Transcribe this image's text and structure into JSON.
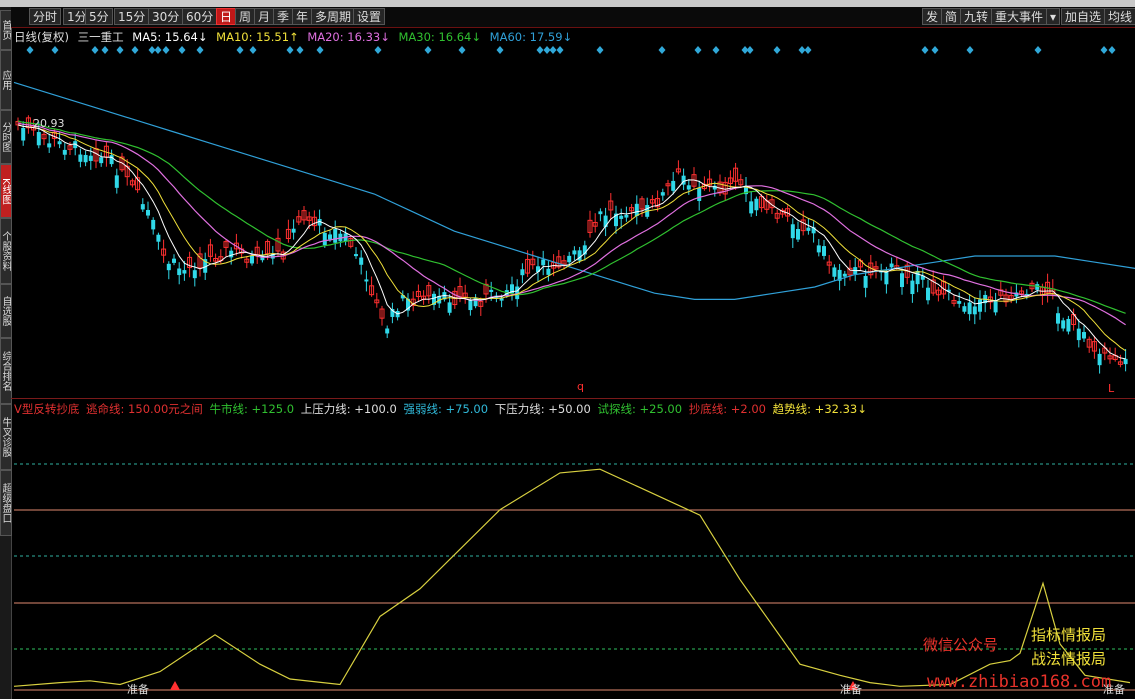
{
  "toolbar": {
    "periods": [
      "分时",
      "1分",
      "5分",
      "15分",
      "30分",
      "60分",
      "日",
      "周",
      "月",
      "季",
      "年",
      "多周期",
      "设置"
    ],
    "active_period": "日",
    "right_buttons": [
      "发",
      "简",
      "九转",
      "重大事件",
      "▾",
      "加自选",
      "均线"
    ]
  },
  "sidebar": {
    "tabs": [
      "首页",
      "应用",
      "分时图",
      "K线图",
      "个股资料",
      "自选股",
      "综合排名",
      "牛叉诊股",
      "超级盘口"
    ],
    "active": "K线图"
  },
  "kline_header": {
    "title": "日线(复权)",
    "stock": "三一重工",
    "ma5": "MA5: 15.64↓",
    "ma10": "MA10: 15.51↑",
    "ma20": "MA20: 16.33↓",
    "ma30": "MA30: 16.64↓",
    "ma60": "MA60: 17.59↓",
    "high_label": "20.93",
    "marker_q": "q",
    "marker_l": "L"
  },
  "colors": {
    "ma5": "#ffffff",
    "ma10": "#f0e03a",
    "ma20": "#e070e0",
    "ma30": "#30c030",
    "ma60": "#30a0d8",
    "up": "#ff3030",
    "down": "#30d8e8",
    "indicator": "#d8d040"
  },
  "indicator_header": {
    "name": "V型反转抄底",
    "escape": "逃命线: 150.00元之间",
    "bull": "牛市线: +125.0",
    "upper": "上压力线: +100.0",
    "strong": "强弱线: +75.00",
    "lower": "下压力线: +50.00",
    "test": "试探线: +25.00",
    "bottom": "抄底线: +2.00",
    "trend": "趋势线: +32.33↓"
  },
  "bottom_labels": [
    "准备",
    "准备",
    "准备"
  ],
  "watermark": {
    "wechat": "微信公众号",
    "line1": "指标情报局",
    "line2": "战法情报局",
    "url": "www.zhibiao168.com"
  },
  "chart_data": {
    "type": "line",
    "title": "三一重工",
    "series": [
      {
        "name": "MA60",
        "values": [
          20.6,
          20.4,
          20.2,
          20.0,
          19.8,
          19.6,
          19.4,
          19.2,
          19.0,
          18.8,
          18.5,
          18.2,
          18.0,
          17.8,
          17.6,
          17.4,
          17.2,
          17.1,
          17.1,
          17.2,
          17.3,
          17.5,
          17.6,
          17.7,
          17.8,
          17.8,
          17.8,
          17.7,
          17.6
        ]
      },
      {
        "name": "trend",
        "values": [
          2,
          4,
          5,
          3,
          10,
          30,
          14,
          6,
          3,
          40,
          55,
          98,
          118,
          120,
          110,
          95,
          60,
          14,
          8,
          4,
          2,
          3,
          14,
          16,
          20,
          58,
          25,
          8,
          4
        ]
      }
    ]
  }
}
